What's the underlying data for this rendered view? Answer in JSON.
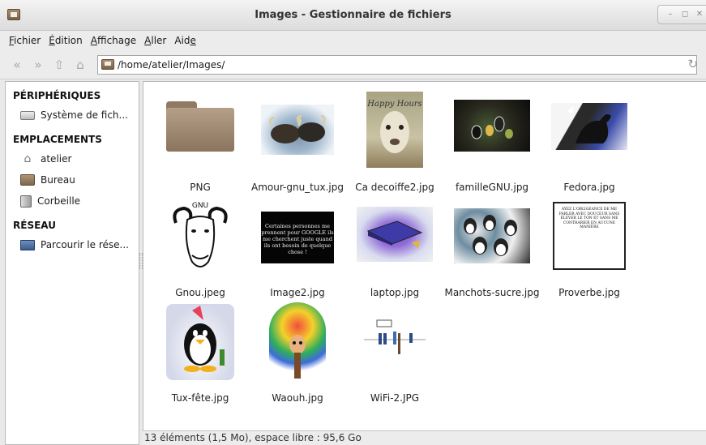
{
  "window": {
    "title": "Images - Gestionnaire de fichiers",
    "buttons": [
      "–",
      "◻",
      "✕"
    ]
  },
  "menubar": [
    {
      "label": "Fichier",
      "mnemonic": "F",
      "rest": "ichier"
    },
    {
      "label": "Édition",
      "mnemonic": "É",
      "rest": "dition"
    },
    {
      "label": "Affichage",
      "mnemonic": "A",
      "rest": "ffichage"
    },
    {
      "label": "Aller",
      "mnemonic": "A",
      "rest": "ller"
    },
    {
      "label": "Aide",
      "pre": "Aid",
      "mnemonic": "e"
    }
  ],
  "toolbar": {
    "back_icon": "«",
    "forward_icon": "»",
    "up_icon": "⇧",
    "home_icon": "⌂",
    "location": "/home/atelier/Images/",
    "reload_icon": "↻"
  },
  "sidebar": {
    "sections": [
      {
        "heading": "PÉRIPHÉRIQUES",
        "items": [
          {
            "label": "Système de fich...",
            "icon": "drive-icon"
          }
        ]
      },
      {
        "heading": "EMPLACEMENTS",
        "items": [
          {
            "label": "atelier",
            "icon": "home-icon"
          },
          {
            "label": "Bureau",
            "icon": "desktop-folder-icon"
          },
          {
            "label": "Corbeille",
            "icon": "trash-icon"
          }
        ]
      },
      {
        "heading": "RÉSEAU",
        "items": [
          {
            "label": "Parcourir le rése...",
            "icon": "network-icon"
          }
        ]
      }
    ]
  },
  "files": [
    {
      "name": "PNG",
      "kind": "folder"
    },
    {
      "name": "Amour-gnu_tux.jpg",
      "kind": "image"
    },
    {
      "name": "Ca decoiffe2.jpg",
      "kind": "image",
      "overlay": "Happy Hours"
    },
    {
      "name": "familleGNU.jpg",
      "kind": "image"
    },
    {
      "name": "Fedora.jpg",
      "kind": "image"
    },
    {
      "name": "Gnou.jpeg",
      "kind": "image",
      "overlay": "GNU"
    },
    {
      "name": "Image2.jpg",
      "kind": "image",
      "overlay": "Certaines personnes me prennent pour GOOGLE ils me cherchent juste quand ils ont besoin de quelque chose !"
    },
    {
      "name": "laptop.jpg",
      "kind": "image"
    },
    {
      "name": "Manchots-sucre.jpg",
      "kind": "image"
    },
    {
      "name": "Proverbe.jpg",
      "kind": "image",
      "overlay": "AYEZ L'OBLIGEANCE DE ME PARLER AVEC DOUCEUR SANS ÉLEVER LE TON ET SANS ME CONTRARIER EN AUCUNE MANIÈRE"
    },
    {
      "name": "Tux-fête.jpg",
      "kind": "image"
    },
    {
      "name": "Waouh.jpg",
      "kind": "image"
    },
    {
      "name": "WiFi-2.JPG",
      "kind": "image"
    }
  ],
  "statusbar": {
    "text": "13 éléments (1,5 Mo), espace libre : 95,6 Go"
  },
  "colors": {
    "folder": "#a48a70",
    "selection": "#86abd9"
  }
}
